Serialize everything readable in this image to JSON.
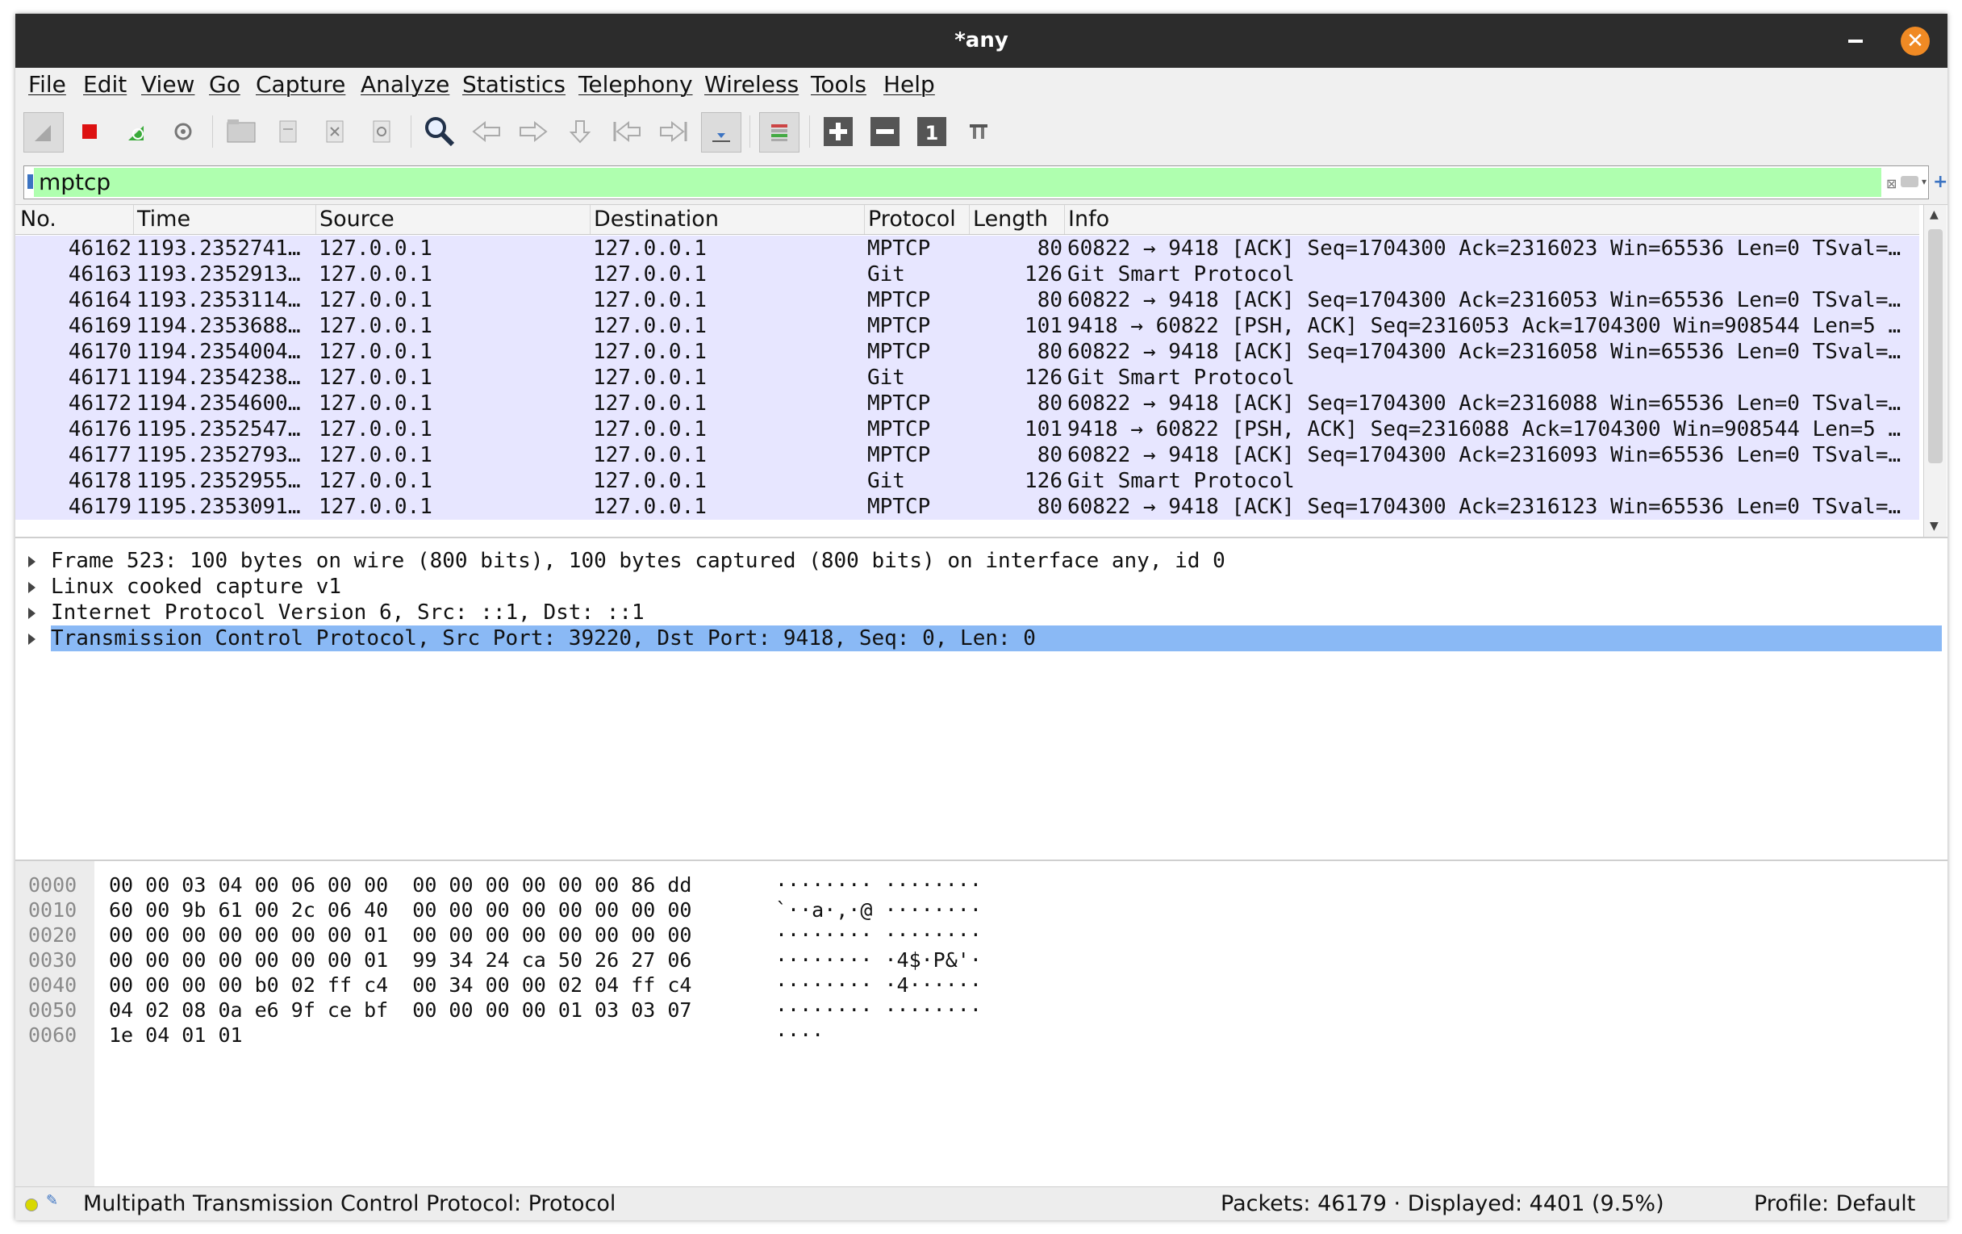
{
  "window": {
    "title": "*any"
  },
  "menu": [
    "File",
    "Edit",
    "View",
    "Go",
    "Capture",
    "Analyze",
    "Statistics",
    "Telephony",
    "Wireless",
    "Tools",
    "Help"
  ],
  "toolbar": {
    "icons": [
      "shark-fin-start-icon",
      "stop-icon",
      "restart-icon",
      "capture-options-icon",
      "open-file-icon",
      "save-file-icon",
      "close-file-icon",
      "reload-icon",
      "find-icon",
      "back-icon",
      "forward-icon",
      "goto-packet-icon",
      "first-packet-icon",
      "last-packet-icon",
      "autoscroll-icon",
      "colorize-icon",
      "zoom-in-icon",
      "zoom-out-icon",
      "normal-size-icon",
      "resize-columns-icon"
    ]
  },
  "filter": {
    "value": "mptcp",
    "bg_color": "#afffaf"
  },
  "packet_list": {
    "columns": [
      "No.",
      "Time",
      "Source",
      "Destination",
      "Protocol",
      "Length",
      "Info"
    ],
    "rows": [
      {
        "no": "46162",
        "time": "1193.2352741…",
        "src": "127.0.0.1",
        "dst": "127.0.0.1",
        "proto": "MPTCP",
        "len": "80",
        "info": "60822 → 9418 [ACK] Seq=1704300 Ack=2316023 Win=65536 Len=0 TSval=…"
      },
      {
        "no": "46163",
        "time": "1193.2352913…",
        "src": "127.0.0.1",
        "dst": "127.0.0.1",
        "proto": "Git",
        "len": "126",
        "info": "Git Smart Protocol"
      },
      {
        "no": "46164",
        "time": "1193.2353114…",
        "src": "127.0.0.1",
        "dst": "127.0.0.1",
        "proto": "MPTCP",
        "len": "80",
        "info": "60822 → 9418 [ACK] Seq=1704300 Ack=2316053 Win=65536 Len=0 TSval=…"
      },
      {
        "no": "46169",
        "time": "1194.2353688…",
        "src": "127.0.0.1",
        "dst": "127.0.0.1",
        "proto": "MPTCP",
        "len": "101",
        "info": "9418 → 60822 [PSH, ACK] Seq=2316053 Ack=1704300 Win=908544 Len=5 …"
      },
      {
        "no": "46170",
        "time": "1194.2354004…",
        "src": "127.0.0.1",
        "dst": "127.0.0.1",
        "proto": "MPTCP",
        "len": "80",
        "info": "60822 → 9418 [ACK] Seq=1704300 Ack=2316058 Win=65536 Len=0 TSval=…"
      },
      {
        "no": "46171",
        "time": "1194.2354238…",
        "src": "127.0.0.1",
        "dst": "127.0.0.1",
        "proto": "Git",
        "len": "126",
        "info": "Git Smart Protocol"
      },
      {
        "no": "46172",
        "time": "1194.2354600…",
        "src": "127.0.0.1",
        "dst": "127.0.0.1",
        "proto": "MPTCP",
        "len": "80",
        "info": "60822 → 9418 [ACK] Seq=1704300 Ack=2316088 Win=65536 Len=0 TSval=…"
      },
      {
        "no": "46176",
        "time": "1195.2352547…",
        "src": "127.0.0.1",
        "dst": "127.0.0.1",
        "proto": "MPTCP",
        "len": "101",
        "info": "9418 → 60822 [PSH, ACK] Seq=2316088 Ack=1704300 Win=908544 Len=5 …"
      },
      {
        "no": "46177",
        "time": "1195.2352793…",
        "src": "127.0.0.1",
        "dst": "127.0.0.1",
        "proto": "MPTCP",
        "len": "80",
        "info": "60822 → 9418 [ACK] Seq=1704300 Ack=2316093 Win=65536 Len=0 TSval=…"
      },
      {
        "no": "46178",
        "time": "1195.2352955…",
        "src": "127.0.0.1",
        "dst": "127.0.0.1",
        "proto": "Git",
        "len": "126",
        "info": "Git Smart Protocol"
      },
      {
        "no": "46179",
        "time": "1195.2353091…",
        "src": "127.0.0.1",
        "dst": "127.0.0.1",
        "proto": "MPTCP",
        "len": "80",
        "info": "60822 → 9418 [ACK] Seq=1704300 Ack=2316123 Win=65536 Len=0 TSval=…"
      }
    ],
    "row_color": "#e7e6ff"
  },
  "details": [
    "Frame 523: 100 bytes on wire (800 bits), 100 bytes captured (800 bits) on interface any, id 0",
    "Linux cooked capture v1",
    "Internet Protocol Version 6, Src: ::1, Dst: ::1",
    "Transmission Control Protocol, Src Port: 39220, Dst Port: 9418, Seq: 0, Len: 0"
  ],
  "bytes": [
    {
      "off": "0000",
      "hex": "00 00 03 04 00 06 00 00  00 00 00 00 00 00 86 dd",
      "ascii": "········ ········"
    },
    {
      "off": "0010",
      "hex": "60 00 9b 61 00 2c 06 40  00 00 00 00 00 00 00 00",
      "ascii": "`··a·,·@ ········"
    },
    {
      "off": "0020",
      "hex": "00 00 00 00 00 00 00 01  00 00 00 00 00 00 00 00",
      "ascii": "········ ········"
    },
    {
      "off": "0030",
      "hex": "00 00 00 00 00 00 00 01  99 34 24 ca 50 26 27 06",
      "ascii": "········ ·4$·P&'·"
    },
    {
      "off": "0040",
      "hex": "00 00 00 00 b0 02 ff c4  00 34 00 00 02 04 ff c4",
      "ascii": "········ ·4······"
    },
    {
      "off": "0050",
      "hex": "04 02 08 0a e6 9f ce bf  00 00 00 00 01 03 03 07",
      "ascii": "········ ········"
    },
    {
      "off": "0060",
      "hex": "1e 04 01 01",
      "ascii": "····"
    }
  ],
  "status": {
    "message": "Multipath Transmission Control Protocol: Protocol",
    "packets": "Packets: 46179 · Displayed: 4401 (9.5%)",
    "profile": "Profile: Default"
  }
}
